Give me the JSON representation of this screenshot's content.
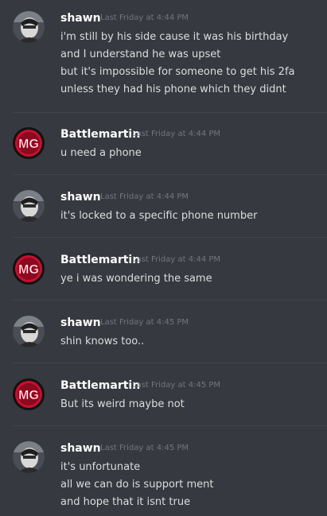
{
  "messages": [
    {
      "author": "shawn",
      "avatar_icon": "shawn-avatar-icon",
      "timestamp": "Last Friday at 4:44 PM",
      "lines": [
        "i'm still by his side cause it was his birthday",
        "and I understand he was upset",
        "but it's impossible for someone to get his 2fa",
        "unless they had his phone which they didnt"
      ]
    },
    {
      "author": "Battlemartin",
      "avatar_icon": "mg-logo-avatar-icon",
      "timestamp": "Last Friday at 4:44 PM",
      "lines": [
        "u need a phone"
      ]
    },
    {
      "author": "shawn",
      "avatar_icon": "shawn-avatar-icon",
      "timestamp": "Last Friday at 4:44 PM",
      "lines": [
        "it's locked to a specific phone number"
      ]
    },
    {
      "author": "Battlemartin",
      "avatar_icon": "mg-logo-avatar-icon",
      "timestamp": "Last Friday at 4:44 PM",
      "lines": [
        "ye i was wondering the same"
      ]
    },
    {
      "author": "shawn",
      "avatar_icon": "shawn-avatar-icon",
      "timestamp": "Last Friday at 4:45 PM",
      "lines": [
        "shin knows too.."
      ]
    },
    {
      "author": "Battlemartin",
      "avatar_icon": "mg-logo-avatar-icon",
      "timestamp": "Last Friday at 4:45 PM",
      "lines": [
        "But its weird maybe not"
      ]
    },
    {
      "author": "shawn",
      "avatar_icon": "shawn-avatar-icon",
      "timestamp": "Last Friday at 4:45 PM",
      "lines": [
        "it's unfortunate",
        "all we can do is support ment",
        "and hope that it isnt true"
      ]
    }
  ],
  "colors": {
    "background": "#36393f",
    "username": "#ffffff",
    "timestamp": "#72767d",
    "message_text": "#dcddde",
    "divider": "#40444b",
    "mg_logo_red": "#c8102e"
  }
}
